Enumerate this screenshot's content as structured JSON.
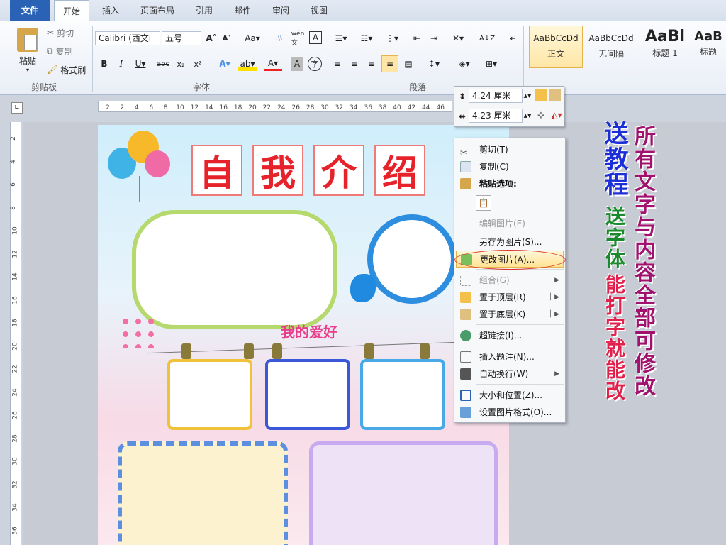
{
  "tabs": [
    "文件",
    "开始",
    "插入",
    "页面布局",
    "引用",
    "邮件",
    "审阅",
    "视图"
  ],
  "clipboard": {
    "paste": "粘贴",
    "cut": "剪切",
    "copy": "复制",
    "format_painter": "格式刷",
    "group": "剪贴板"
  },
  "font": {
    "name": "Calibri (西文i",
    "size": "五号",
    "group": "字体"
  },
  "paragraph": {
    "group": "段落"
  },
  "styles": [
    {
      "preview": "AaBbCcDd",
      "name": "正文"
    },
    {
      "preview": "AaBbCcDd",
      "name": "无间隔"
    },
    {
      "preview": "AaBl",
      "name": "标题 1"
    },
    {
      "preview": "AaB",
      "name": "标题"
    }
  ],
  "ruler": {
    "ticks": [
      "2",
      "2",
      "4",
      "6",
      "8",
      "10",
      "12",
      "14",
      "16",
      "18",
      "20",
      "22",
      "24",
      "26",
      "28",
      "30",
      "32",
      "34",
      "36",
      "38",
      "40",
      "42",
      "44",
      "46"
    ]
  },
  "vruler": {
    "ticks": [
      "2",
      "4",
      "6",
      "8",
      "10",
      "12",
      "14",
      "16",
      "18",
      "20",
      "22",
      "24",
      "26",
      "28",
      "30",
      "32",
      "34",
      "36"
    ]
  },
  "mini": {
    "height": "4.24 厘米",
    "width": "4.23 厘米"
  },
  "doc": {
    "title_chars": [
      "自",
      "我",
      "介",
      "绍"
    ],
    "hobby": "我的爱好"
  },
  "menu": {
    "items": [
      {
        "label": "剪切(T)",
        "disabled": false
      },
      {
        "label": "复制(C)",
        "disabled": false
      },
      {
        "label": "粘贴选项:",
        "disabled": false
      },
      {
        "label": "编辑图片(E)",
        "disabled": true
      },
      {
        "label": "另存为图片(S)...",
        "disabled": false
      },
      {
        "label": "更改图片(A)...",
        "disabled": false
      },
      {
        "label": "组合(G)",
        "disabled": true
      },
      {
        "label": "置于顶层(R)",
        "disabled": false
      },
      {
        "label": "置于底层(K)",
        "disabled": false
      },
      {
        "label": "超链接(I)...",
        "disabled": false
      },
      {
        "label": "插入题注(N)...",
        "disabled": false
      },
      {
        "label": "自动换行(W)",
        "disabled": false
      },
      {
        "label": "大小和位置(Z)...",
        "disabled": false
      },
      {
        "label": "设置图片格式(O)...",
        "disabled": false
      }
    ]
  },
  "promo": {
    "col1": "所有文字与内容全部可修改",
    "col2a": "送教程",
    "col2b": "送字体",
    "col3": "能打字就能改"
  },
  "colors": {
    "accent": "#2a62b5",
    "title_red": "#e6232a",
    "promo_purple": "#a0126e",
    "promo_blue": "#1c2fd6",
    "promo_green": "#1b8a2d",
    "promo_red": "#e2204c"
  }
}
